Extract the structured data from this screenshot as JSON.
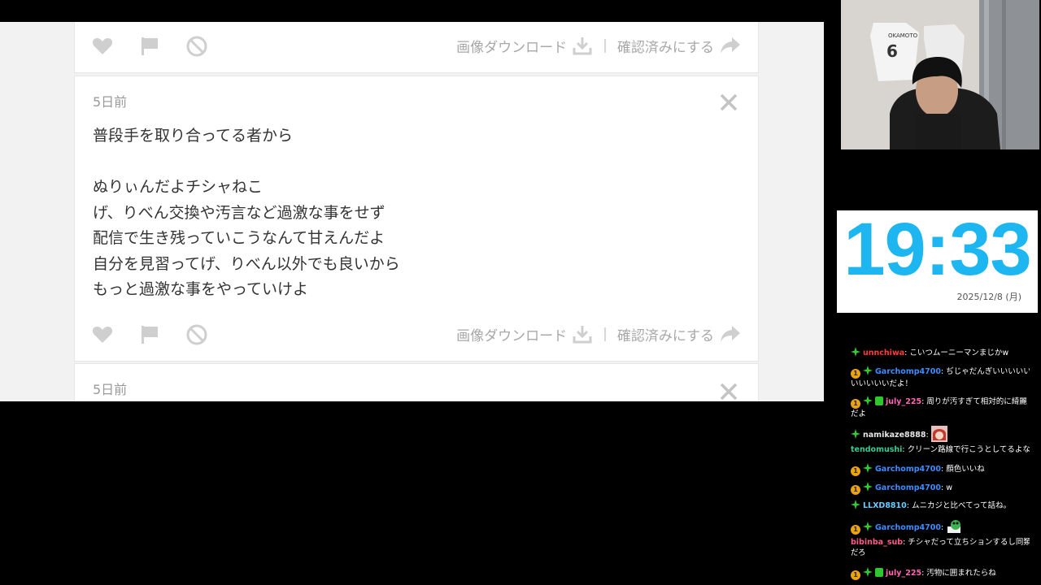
{
  "browser": {
    "actions": {
      "download_label": "画像ダウンロード",
      "separator": "|",
      "confirm_label": "確認済みにする"
    },
    "message": {
      "time": "5日前",
      "lines": [
        "普段手を取り合ってる者から",
        "",
        "ぬりぃんだよチシャねこ",
        "げ、りべん交換や汚言など過激な事をせず",
        "配信で生き残っていこうなんて甘えんだよ",
        "自分を見習ってげ、りべん以外でも良いから",
        "もっと過激な事をやっていけよ"
      ]
    },
    "next_message": {
      "time": "5日前"
    }
  },
  "clock": {
    "time": "19:33",
    "date": "2025/12/8 (月)",
    "color": "#1eb6f0"
  },
  "webcam": {
    "jersey_name": "OKAMOTO",
    "jersey_number": "6"
  },
  "chat": {
    "messages": [
      {
        "sub": false,
        "name": "unnchiwa",
        "name_color": "#ff3b3b",
        "text": "こいつムーニーマンまじかw"
      },
      {
        "sub": true,
        "name": "Garchomp4700",
        "name_color": "#3d8cff",
        "text": "ぢじゃだんぎいいいいいいいいいいだよ！"
      },
      {
        "sub": true,
        "gift": true,
        "name": "july_225",
        "name_color": "#ff66b3",
        "text": "周りが汚すぎて相対的に綺麗だよ"
      },
      {
        "sub": false,
        "name": "namikaze8888",
        "name_color": "#e6e6e6",
        "text": "",
        "emote": "anime-girl-emote"
      },
      {
        "sub": false,
        "nobadge": true,
        "name": "tendomushi",
        "name_color": "#33cc99",
        "text": "クリーン路線で行こうとしてるよな"
      },
      {
        "sub": true,
        "name": "Garchomp4700",
        "name_color": "#3d8cff",
        "text": "顔色いいね"
      },
      {
        "sub": true,
        "name": "Garchomp4700",
        "name_color": "#3d8cff",
        "text": "w"
      },
      {
        "sub": false,
        "name": "LLXD8810",
        "name_color": "#66ccff",
        "text": "ムニカジと比べてって話ね。"
      },
      {
        "sub": true,
        "name": "Garchomp4700",
        "name_color": "#3d8cff",
        "text": "",
        "emote": "frog-emote"
      },
      {
        "sub": false,
        "nobadge": true,
        "name": "bibinba_sub",
        "name_color": "#ff5c8a",
        "text": "チシャだって立ちションするし同類だろ"
      },
      {
        "sub": true,
        "gift": true,
        "name": "july_225",
        "name_color": "#ff66b3",
        "text": "汚物に囲まれたらね"
      }
    ]
  }
}
